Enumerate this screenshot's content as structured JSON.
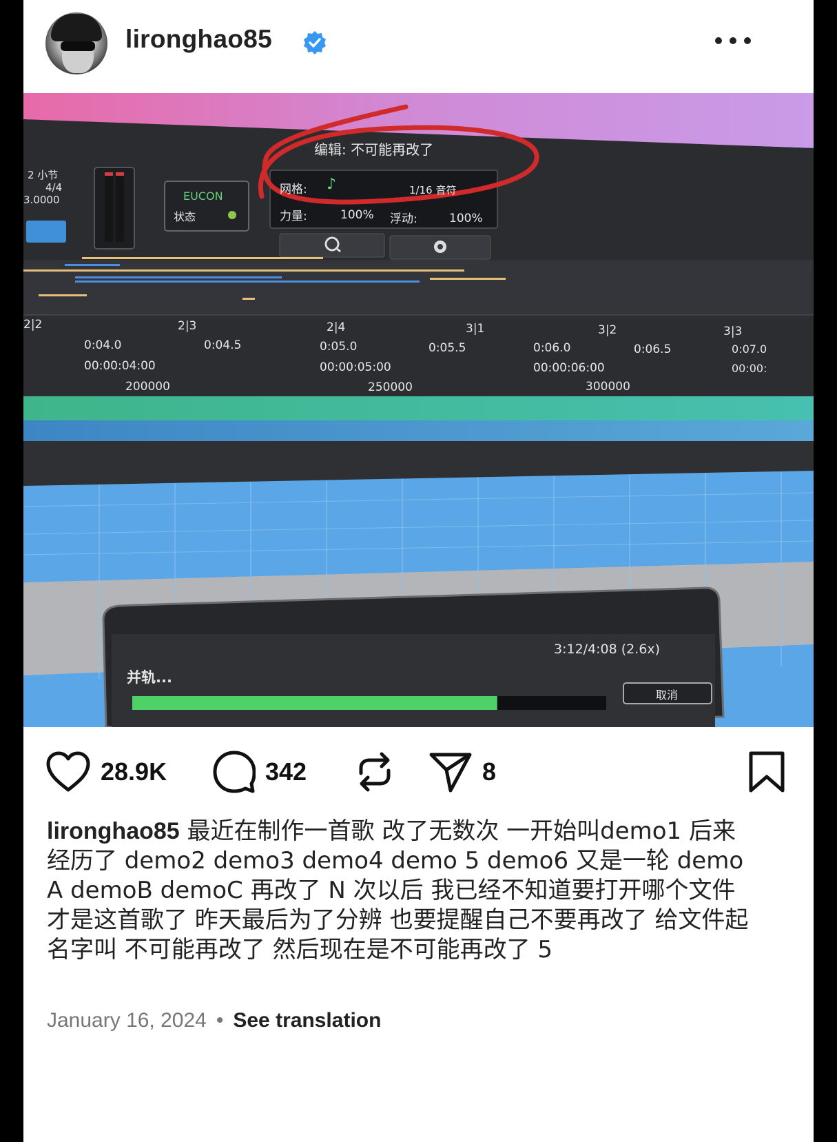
{
  "post": {
    "username": "lironghao85",
    "verified": true
  },
  "photo": {
    "edit_label": "编辑:",
    "edit_value": "不可能再改了",
    "bars_label": "2 小节",
    "meter": "4/4",
    "tempo": "3.0000",
    "eucon_label": "EUCON",
    "status_label": "状态",
    "grid_label": "网格:",
    "grid_value": "1/16 音符",
    "velocity_label": "力量:",
    "velocity_value": "100%",
    "swing_label": "浮动:",
    "swing_value": "100%",
    "ruler": {
      "bars": [
        "2|2",
        "2|3",
        "2|4",
        "3|1",
        "3|2",
        "3|3"
      ],
      "seconds": [
        "0:04.0",
        "0:04.5",
        "0:05.0",
        "0:05.5",
        "0:06.0",
        "0:06.5",
        "0:07.0"
      ],
      "timecode": [
        "00:00:04:00",
        "00:00:05:00",
        "00:00:06:00",
        "00:00:"
      ],
      "samples": [
        "200000",
        "250000",
        "300000"
      ]
    },
    "bounce_dialog": {
      "title": "并轨...",
      "progress_text": "3:12/4:08 (2.6x)",
      "progress_fraction": 0.77,
      "cancel_label": "取消"
    }
  },
  "actions": {
    "likes": "28.9K",
    "comments": "342",
    "shares": "8"
  },
  "caption": {
    "username": "lironghao85",
    "text": " 最近在制作一首歌 改了无数次 一开始叫demo1 后来经历了 demo2 demo3 demo4 demo 5 demo6 又是一轮 demo A demoB demoC 再改了 N 次以后 我已经不知道要打开哪个文件才是这首歌了 昨天最后为了分辨 也要提醒自己不要再改了 给文件起名字叫 不可能再改了 然后现在是不可能再改了 5"
  },
  "meta": {
    "date": "January 16, 2024",
    "separator": "•",
    "translate": "See translation"
  }
}
